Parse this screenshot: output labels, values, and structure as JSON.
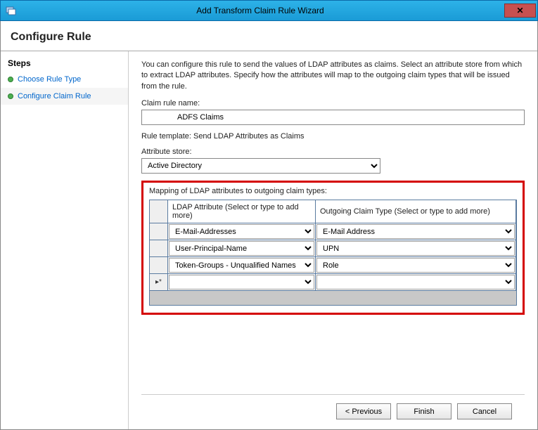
{
  "titlebar": {
    "title": "Add Transform Claim Rule Wizard"
  },
  "page_header": "Configure Rule",
  "sidebar": {
    "heading": "Steps",
    "items": [
      {
        "label": "Choose Rule Type"
      },
      {
        "label": "Configure Claim Rule"
      }
    ]
  },
  "main": {
    "intro": "You can configure this rule to send the values of LDAP attributes as claims. Select an attribute store from which to extract LDAP attributes. Specify how the attributes will map to the outgoing claim types that will be issued from the rule.",
    "claim_rule_name_label": "Claim rule name:",
    "claim_rule_name_value": "ADFS Claims",
    "rule_template_label": "Rule template: Send LDAP Attributes as Claims",
    "attribute_store_label": "Attribute store:",
    "attribute_store_value": "Active Directory",
    "mapping_label": "Mapping of LDAP attributes to outgoing claim types:",
    "grid": {
      "headers": {
        "ldap": "LDAP Attribute (Select or type to add more)",
        "claim": "Outgoing Claim Type (Select or type to add more)"
      },
      "rows": [
        {
          "ldap": "E-Mail-Addresses",
          "claim": "E-Mail Address"
        },
        {
          "ldap": "User-Principal-Name",
          "claim": "UPN"
        },
        {
          "ldap": "Token-Groups - Unqualified Names",
          "claim": "Role"
        },
        {
          "ldap": "",
          "claim": ""
        }
      ],
      "new_row_marker": "▸*"
    }
  },
  "buttons": {
    "previous": "< Previous",
    "finish": "Finish",
    "cancel": "Cancel"
  }
}
